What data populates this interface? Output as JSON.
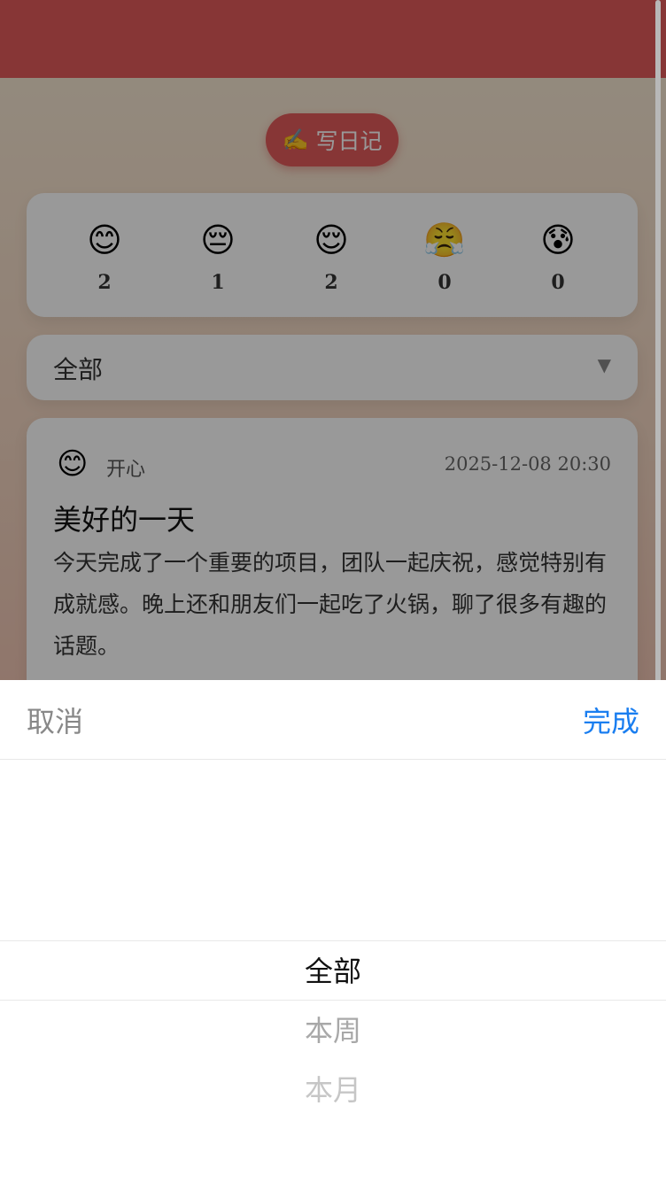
{
  "write_button": {
    "icon": "✍️",
    "label": "写日记"
  },
  "stats": [
    {
      "icon": "😊",
      "mood": "happy",
      "count": "2"
    },
    {
      "icon": "😔",
      "mood": "sad",
      "count": "1"
    },
    {
      "icon": "😌",
      "mood": "calm",
      "count": "2"
    },
    {
      "icon": "😤",
      "mood": "angry",
      "count": "0"
    },
    {
      "icon": "😰",
      "mood": "anxious",
      "count": "0"
    }
  ],
  "filter": {
    "value": "全部",
    "arrow": "▼"
  },
  "diary": {
    "emoji": "😊",
    "mood": "开心",
    "date": "2025-12-08 20:30",
    "title": "美好的一天",
    "content": "今天完成了一个重要的项目，团队一起庆祝，感觉特别有成就感。晚上还和朋友们一起吃了火锅，聊了很多有趣的话题。"
  },
  "picker": {
    "cancel": "取消",
    "done": "完成",
    "options": [
      "全部",
      "本周",
      "本月"
    ],
    "selected": "全部"
  },
  "colors": {
    "header": "#e25a5a",
    "accent": "#1a7ef0"
  }
}
